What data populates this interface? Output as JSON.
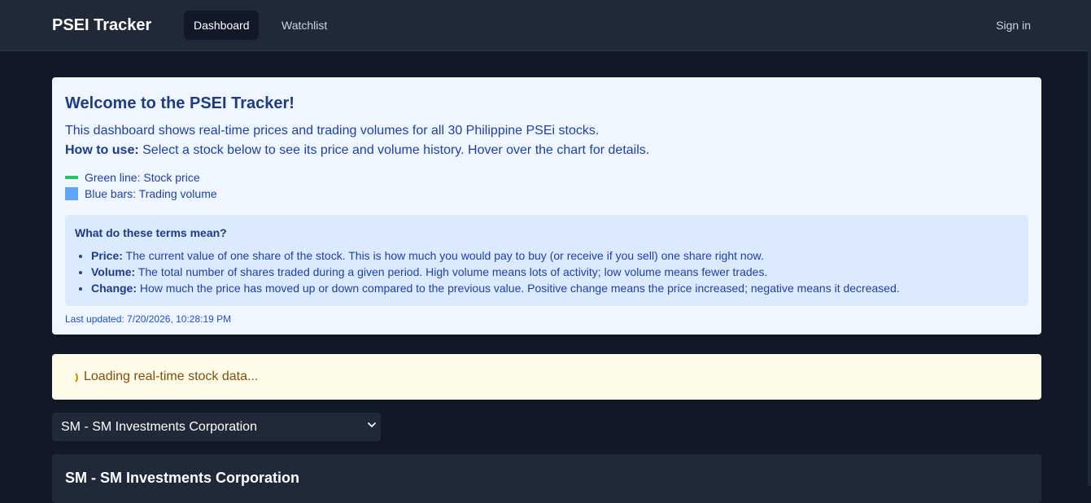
{
  "header": {
    "brand": "PSEI Tracker",
    "tabs": [
      {
        "label": "Dashboard",
        "active": true
      },
      {
        "label": "Watchlist",
        "active": false
      }
    ],
    "signin_label": "Sign in"
  },
  "welcome": {
    "title": "Welcome to the PSEI Tracker!",
    "intro": "This dashboard shows real-time prices and trading volumes for all 30 Philippine PSEi stocks.",
    "howto_label": "How to use:",
    "howto_text": " Select a stock below to see its price and volume history. Hover over the chart for details.",
    "legend": [
      {
        "label": "Green line: Stock price",
        "color": "#22c55e"
      },
      {
        "label": "Blue bars: Trading volume",
        "color": "#60a5fa"
      }
    ],
    "terms": {
      "title": "What do these terms mean?",
      "items": [
        {
          "term": "Price:",
          "definition": " The current value of one share of the stock. This is how much you would pay to buy (or receive if you sell) one share right now."
        },
        {
          "term": "Volume:",
          "definition": " The total number of shares traded during a given period. High volume means lots of activity; low volume means fewer trades."
        },
        {
          "term": "Change:",
          "definition": " How much the price has moved up or down compared to the previous value. Positive change means the price increased; negative means it decreased."
        }
      ]
    },
    "last_updated": "Last updated: 7/20/2026, 10:28:19 PM"
  },
  "loading": {
    "message": "Loading real-time stock data..."
  },
  "stock_select": {
    "selected": "SM - SM Investments Corporation"
  },
  "stock_card": {
    "title": "SM - SM Investments Corporation"
  },
  "colors": {
    "background": "#111827",
    "panel": "#1f2937",
    "welcome_bg": "#eff6ff",
    "loading_bg": "#fefce8"
  }
}
